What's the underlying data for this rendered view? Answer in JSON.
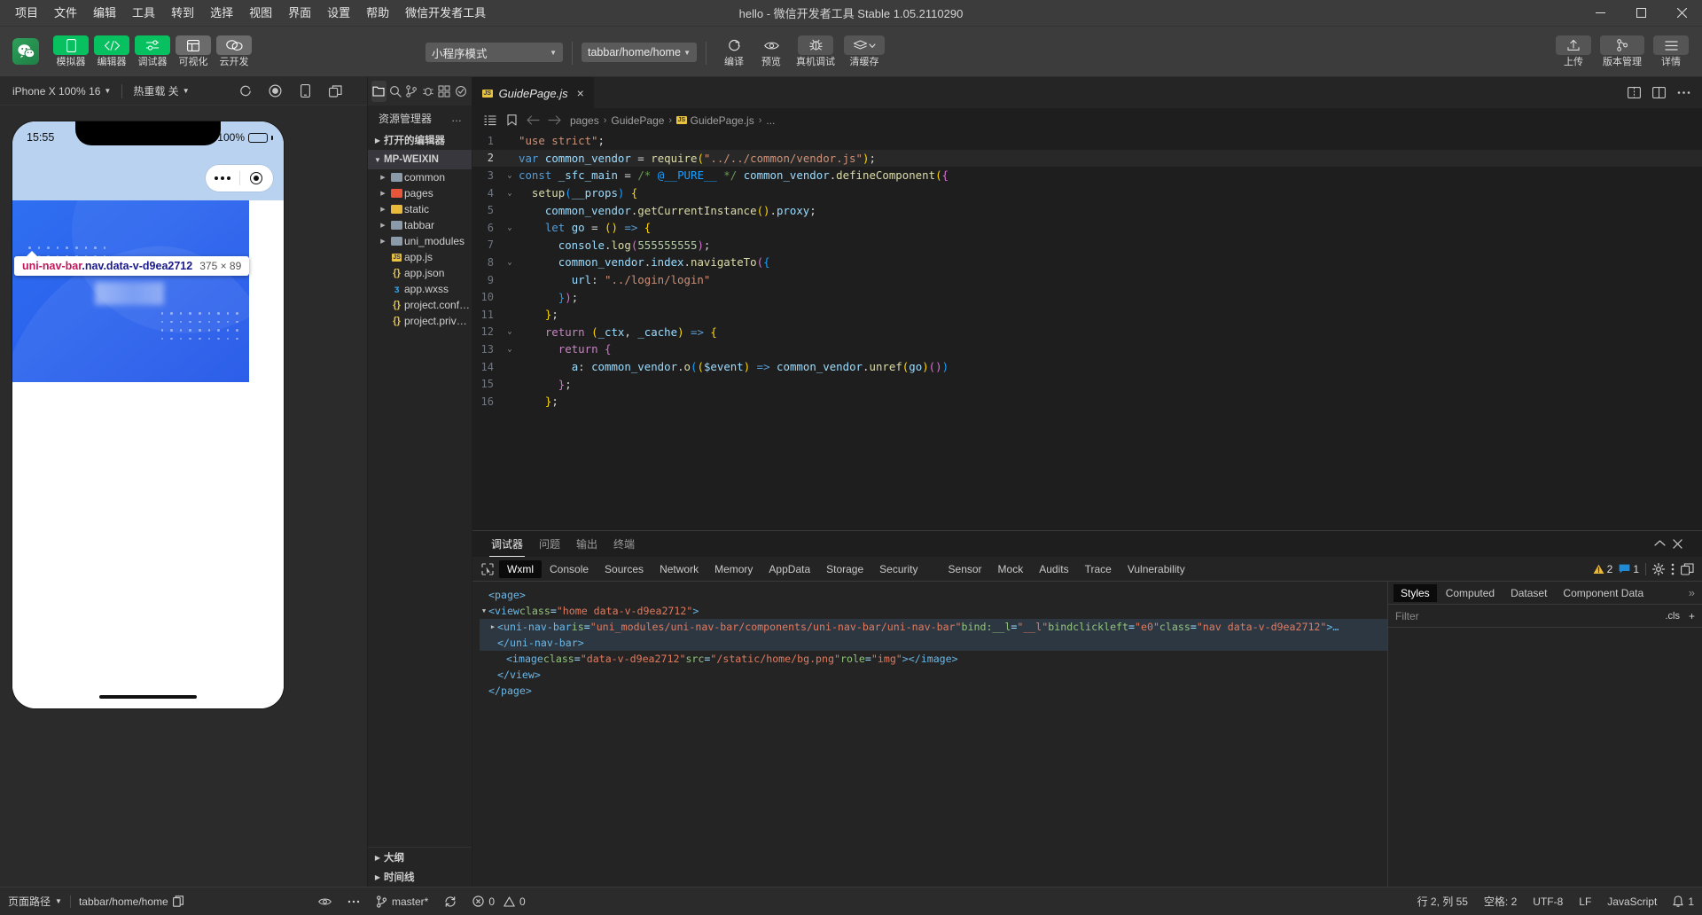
{
  "titlebar": {
    "menus": [
      "项目",
      "文件",
      "编辑",
      "工具",
      "转到",
      "选择",
      "视图",
      "界面",
      "设置",
      "帮助",
      "微信开发者工具"
    ],
    "title": "hello - 微信开发者工具 Stable 1.05.2110290",
    "minimize": "minimize-icon",
    "maximize": "maximize-icon",
    "close": "close-icon"
  },
  "toolbar": {
    "left_buttons": [
      {
        "label": "模拟器",
        "icon": "phone-icon",
        "style": "green"
      },
      {
        "label": "编辑器",
        "icon": "code-icon",
        "style": "green"
      },
      {
        "label": "调试器",
        "icon": "sliders-icon",
        "style": "green"
      },
      {
        "label": "可视化",
        "icon": "layout-icon",
        "style": "grey"
      },
      {
        "label": "云开发",
        "icon": "cloud-icon",
        "style": "grey"
      }
    ],
    "mode_select": "小程序模式",
    "page_select": "tabbar/home/home",
    "actions": [
      {
        "label": "编译",
        "icon": "refresh-icon"
      },
      {
        "label": "预览",
        "icon": "eye-icon"
      },
      {
        "label": "真机调试",
        "icon": "bug-icon"
      },
      {
        "label": "清缓存",
        "icon": "layers-icon"
      }
    ],
    "right_buttons": [
      {
        "label": "上传",
        "icon": "upload-icon"
      },
      {
        "label": "版本管理",
        "icon": "branch-icon"
      },
      {
        "label": "详情",
        "icon": "menu-icon"
      }
    ]
  },
  "simulator": {
    "device_select": "iPhone X 100% 16",
    "hotreload_select": "热重载 关",
    "icons": [
      "refresh-icon",
      "record-icon",
      "device-icon",
      "popout-icon"
    ],
    "phone": {
      "clock": "15:55",
      "battery": "100%",
      "inspect_selector_a": "uni-nav-bar",
      "inspect_selector_b": ".nav.data-v-d9ea2712",
      "inspect_size": "375 × 89"
    }
  },
  "explorer": {
    "title": "资源管理器",
    "overflow": "…",
    "sections": {
      "open_editors": "打开的编辑器",
      "project": "MP-WEIXIN",
      "outline": "大纲",
      "timeline": "时间线"
    },
    "items": [
      {
        "name": "common",
        "type": "folder",
        "color": "#8a9aa8",
        "expandable": true
      },
      {
        "name": "pages",
        "type": "folder",
        "color": "#e8553a",
        "expandable": true
      },
      {
        "name": "static",
        "type": "folder",
        "color": "#e8b93a",
        "expandable": true
      },
      {
        "name": "tabbar",
        "type": "folder",
        "color": "#8a9aa8",
        "expandable": true
      },
      {
        "name": "uni_modules",
        "type": "folder",
        "color": "#8a9aa8",
        "expandable": true
      },
      {
        "name": "app.js",
        "type": "js",
        "expandable": false
      },
      {
        "name": "app.json",
        "type": "json",
        "expandable": false
      },
      {
        "name": "app.wxss",
        "type": "wxss",
        "expandable": false
      },
      {
        "name": "project.config.json",
        "type": "json",
        "expandable": false
      },
      {
        "name": "project.private.config.js...",
        "type": "json",
        "expandable": false
      }
    ],
    "tabs": [
      "files-icon",
      "search-icon",
      "branch-icon",
      "debug-icon",
      "extensions-icon",
      "test-icon"
    ]
  },
  "editor": {
    "tab": {
      "label": "GuidePage.js",
      "close": "×"
    },
    "breadcrumb": [
      "pages",
      "GuidePage",
      "GuidePage.js",
      "..."
    ],
    "lines": [
      {
        "n": 1,
        "fold": "",
        "hl": false
      },
      {
        "n": 2,
        "fold": "",
        "hl": true
      },
      {
        "n": 3,
        "fold": "v",
        "hl": false
      },
      {
        "n": 4,
        "fold": "v",
        "hl": false
      },
      {
        "n": 5,
        "fold": "",
        "hl": false
      },
      {
        "n": 6,
        "fold": "v",
        "hl": false
      },
      {
        "n": 7,
        "fold": "",
        "hl": false
      },
      {
        "n": 8,
        "fold": "v",
        "hl": false
      },
      {
        "n": 9,
        "fold": "",
        "hl": false
      },
      {
        "n": 10,
        "fold": "",
        "hl": false
      },
      {
        "n": 11,
        "fold": "",
        "hl": false
      },
      {
        "n": 12,
        "fold": "v",
        "hl": false
      },
      {
        "n": 13,
        "fold": "v",
        "hl": false
      },
      {
        "n": 14,
        "fold": "",
        "hl": false
      },
      {
        "n": 15,
        "fold": "",
        "hl": false
      },
      {
        "n": 16,
        "fold": "",
        "hl": false
      }
    ],
    "code_text": [
      "\"use strict\";",
      "var common_vendor = require(\"../../common/vendor.js\");",
      "const _sfc_main = /* @__PURE__ */ common_vendor.defineComponent({",
      "  setup(__props) {",
      "    common_vendor.getCurrentInstance().proxy;",
      "    let go = () => {",
      "      console.log(555555555);",
      "      common_vendor.index.navigateTo({",
      "        url: \"../login/login\"",
      "      });",
      "    };",
      "    return (_ctx, _cache) => {",
      "      return {",
      "        a: common_vendor.o(($event) => common_vendor.unref(go)())",
      "      };",
      "    };"
    ]
  },
  "debugger": {
    "panel_tabs": [
      "调试器",
      "问题",
      "输出",
      "终端"
    ],
    "active_panel_tab": "调试器",
    "devtool_tabs": [
      "Wxml",
      "Console",
      "Sources",
      "Network",
      "Memory",
      "AppData",
      "Storage",
      "Security",
      "Sensor",
      "Mock",
      "Audits",
      "Trace",
      "Vulnerability"
    ],
    "active_devtool_tab": "Wxml",
    "warnings": "2",
    "messages": "1",
    "wxml": [
      {
        "indent": 0,
        "tw": "",
        "sel": false,
        "parts": [
          {
            "t": "<page>",
            "c": "tag"
          }
        ]
      },
      {
        "indent": 0,
        "tw": "v",
        "sel": false,
        "parts": [
          {
            "t": "<view ",
            "c": "tag"
          },
          {
            "t": "class",
            "c": "attr"
          },
          {
            "t": "=",
            "c": "punc"
          },
          {
            "t": "\"home data-v-d9ea2712\"",
            "c": "val"
          },
          {
            "t": ">",
            "c": "tag"
          }
        ]
      },
      {
        "indent": 1,
        "tw": ">",
        "sel": true,
        "parts": [
          {
            "t": "<uni-nav-bar ",
            "c": "tag"
          },
          {
            "t": "is",
            "c": "attr"
          },
          {
            "t": "=",
            "c": "punc"
          },
          {
            "t": "\"uni_modules/uni-nav-bar/components/uni-nav-bar/uni-nav-bar\"",
            "c": "val"
          },
          {
            "t": " bind:__l",
            "c": "attr"
          },
          {
            "t": "=",
            "c": "punc"
          },
          {
            "t": "\"__l\"",
            "c": "val"
          },
          {
            "t": " bindclickleft",
            "c": "attr"
          },
          {
            "t": "=",
            "c": "punc"
          },
          {
            "t": "\"e0\"",
            "c": "val"
          },
          {
            "t": " class",
            "c": "attr"
          },
          {
            "t": "=",
            "c": "punc"
          },
          {
            "t": "\"nav data-v-d9ea2712\"",
            "c": "val"
          },
          {
            "t": ">…",
            "c": "tag"
          }
        ]
      },
      {
        "indent": 1,
        "tw": "",
        "sel": true,
        "parts": [
          {
            "t": "</uni-nav-bar>",
            "c": "tag"
          }
        ]
      },
      {
        "indent": 2,
        "tw": "",
        "sel": false,
        "parts": [
          {
            "t": "<image ",
            "c": "tag"
          },
          {
            "t": "class",
            "c": "attr"
          },
          {
            "t": "=",
            "c": "punc"
          },
          {
            "t": "\"data-v-d9ea2712\"",
            "c": "val"
          },
          {
            "t": " src",
            "c": "attr"
          },
          {
            "t": "=",
            "c": "punc"
          },
          {
            "t": "\"/static/home/bg.png\"",
            "c": "val"
          },
          {
            "t": " role",
            "c": "attr"
          },
          {
            "t": "=",
            "c": "punc"
          },
          {
            "t": "\"img\"",
            "c": "val"
          },
          {
            "t": "></image>",
            "c": "tag"
          }
        ]
      },
      {
        "indent": 1,
        "tw": "",
        "sel": false,
        "parts": [
          {
            "t": "</view>",
            "c": "tag"
          }
        ]
      },
      {
        "indent": 0,
        "tw": "",
        "sel": false,
        "parts": [
          {
            "t": "</page>",
            "c": "tag"
          }
        ]
      }
    ],
    "styles_tabs": [
      "Styles",
      "Computed",
      "Dataset",
      "Component Data"
    ],
    "active_styles_tab": "Styles",
    "styles_more": "»",
    "filter_placeholder": "Filter",
    "cls_label": ".cls",
    "add_rule": "+"
  },
  "statusbar": {
    "page_path_label": "页面路径",
    "page_path_value": "tabbar/home/home",
    "copy_icon": "copy-icon",
    "eye_icon": "eye-icon",
    "more_icon": "more-icon",
    "branch": "master*",
    "sync_icon": "sync-icon",
    "errors": "0",
    "warnings": "0",
    "cursor": "行 2, 列 55",
    "spaces": "空格: 2",
    "encoding": "UTF-8",
    "eol": "LF",
    "language": "JavaScript",
    "notifications": "1"
  },
  "colors": {
    "accent_green": "#07c160",
    "panel_bg": "#252526",
    "editor_bg": "#1e1e1e",
    "chrome_bg": "#3c3c3c"
  }
}
